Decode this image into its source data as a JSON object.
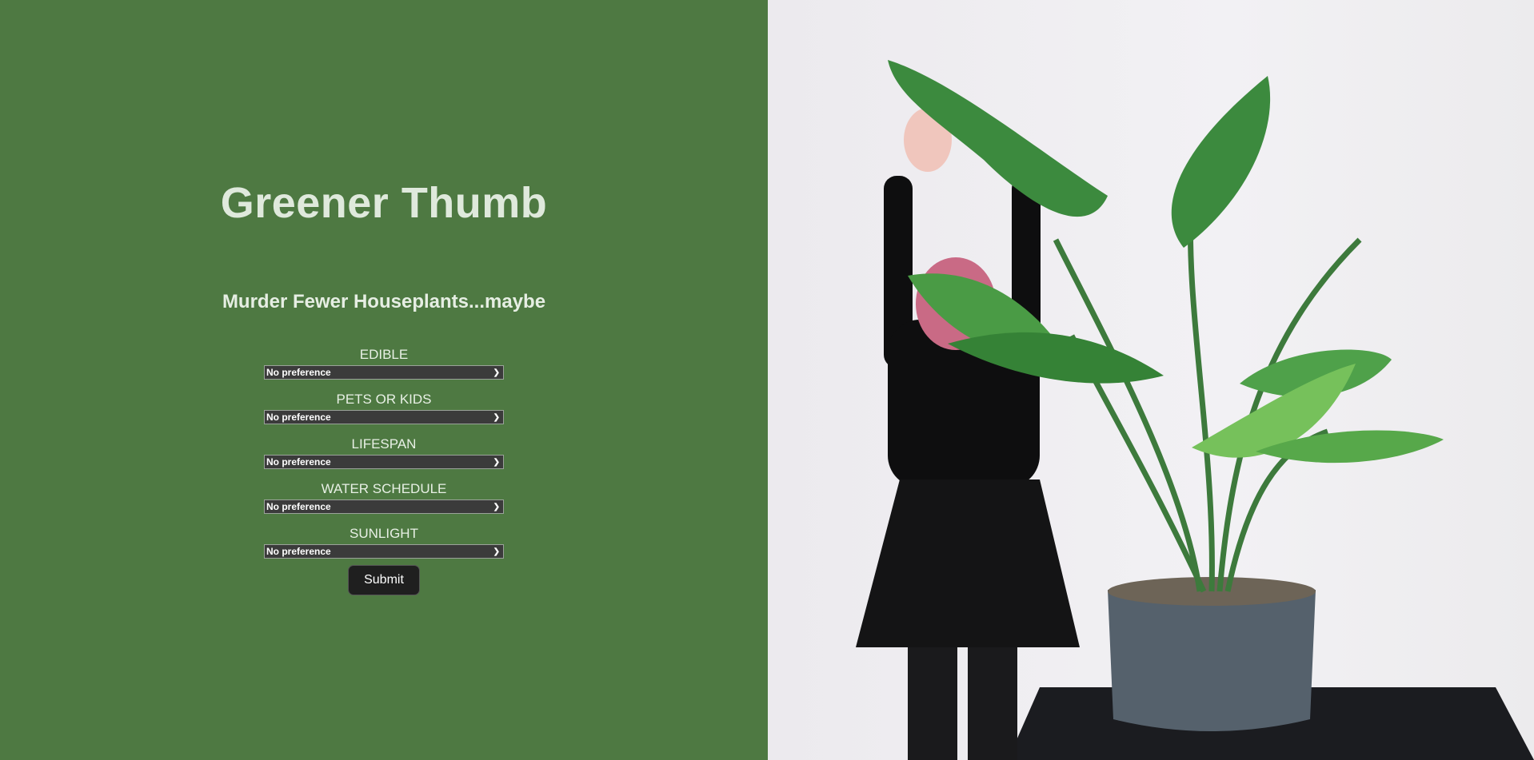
{
  "header": {
    "title": "Greener Thumb",
    "tagline": "Murder Fewer Houseplants...maybe"
  },
  "form": {
    "fields": [
      {
        "label": "EDIBLE",
        "value": "No preference"
      },
      {
        "label": "PETS OR KIDS",
        "value": "No preference"
      },
      {
        "label": "LIFESPAN",
        "value": "No preference"
      },
      {
        "label": "WATER SCHEDULE",
        "value": "No preference"
      },
      {
        "label": "SUNLIGHT",
        "value": "No preference"
      }
    ],
    "submit_label": "Submit"
  },
  "colors": {
    "panel_green": "#4e7942",
    "button_dark": "#1f1f1f"
  },
  "hero_image": {
    "subject": "person-with-bird-of-paradise-plant-photo"
  }
}
